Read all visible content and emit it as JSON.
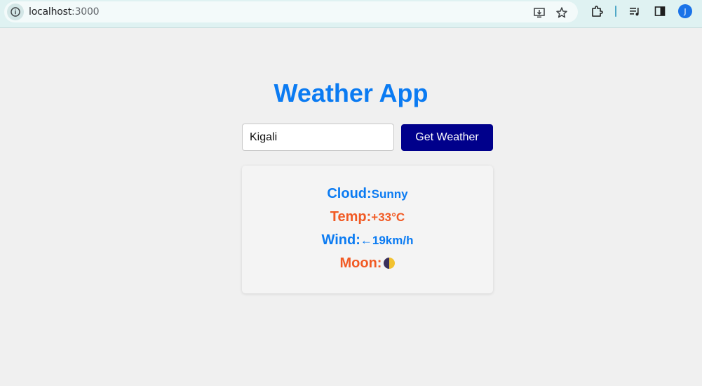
{
  "browser": {
    "url_host": "localhost",
    "url_port": ":3000",
    "profile_initial": "J",
    "icons": [
      "info-icon",
      "install-icon",
      "bookmark-star-icon",
      "extensions-icon",
      "media-control-icon",
      "side-panel-icon"
    ]
  },
  "app": {
    "title": "Weather App",
    "search": {
      "value": "Kigali",
      "placeholder": "",
      "button_label": "Get Weather"
    },
    "weather": {
      "cloud_label": "Cloud:",
      "cloud_value": "Sunny",
      "temp_label": "Temp:",
      "temp_value": "+33°C",
      "wind_label": "Wind:",
      "wind_value": "←19km/h",
      "moon_label": "Moon:",
      "moon_icon": "half-moon-icon"
    }
  },
  "colors": {
    "accent_blue": "#0b7bf2",
    "accent_orange": "#f15a24",
    "button_bg": "#00008b",
    "page_bg": "#f0f0f0"
  }
}
